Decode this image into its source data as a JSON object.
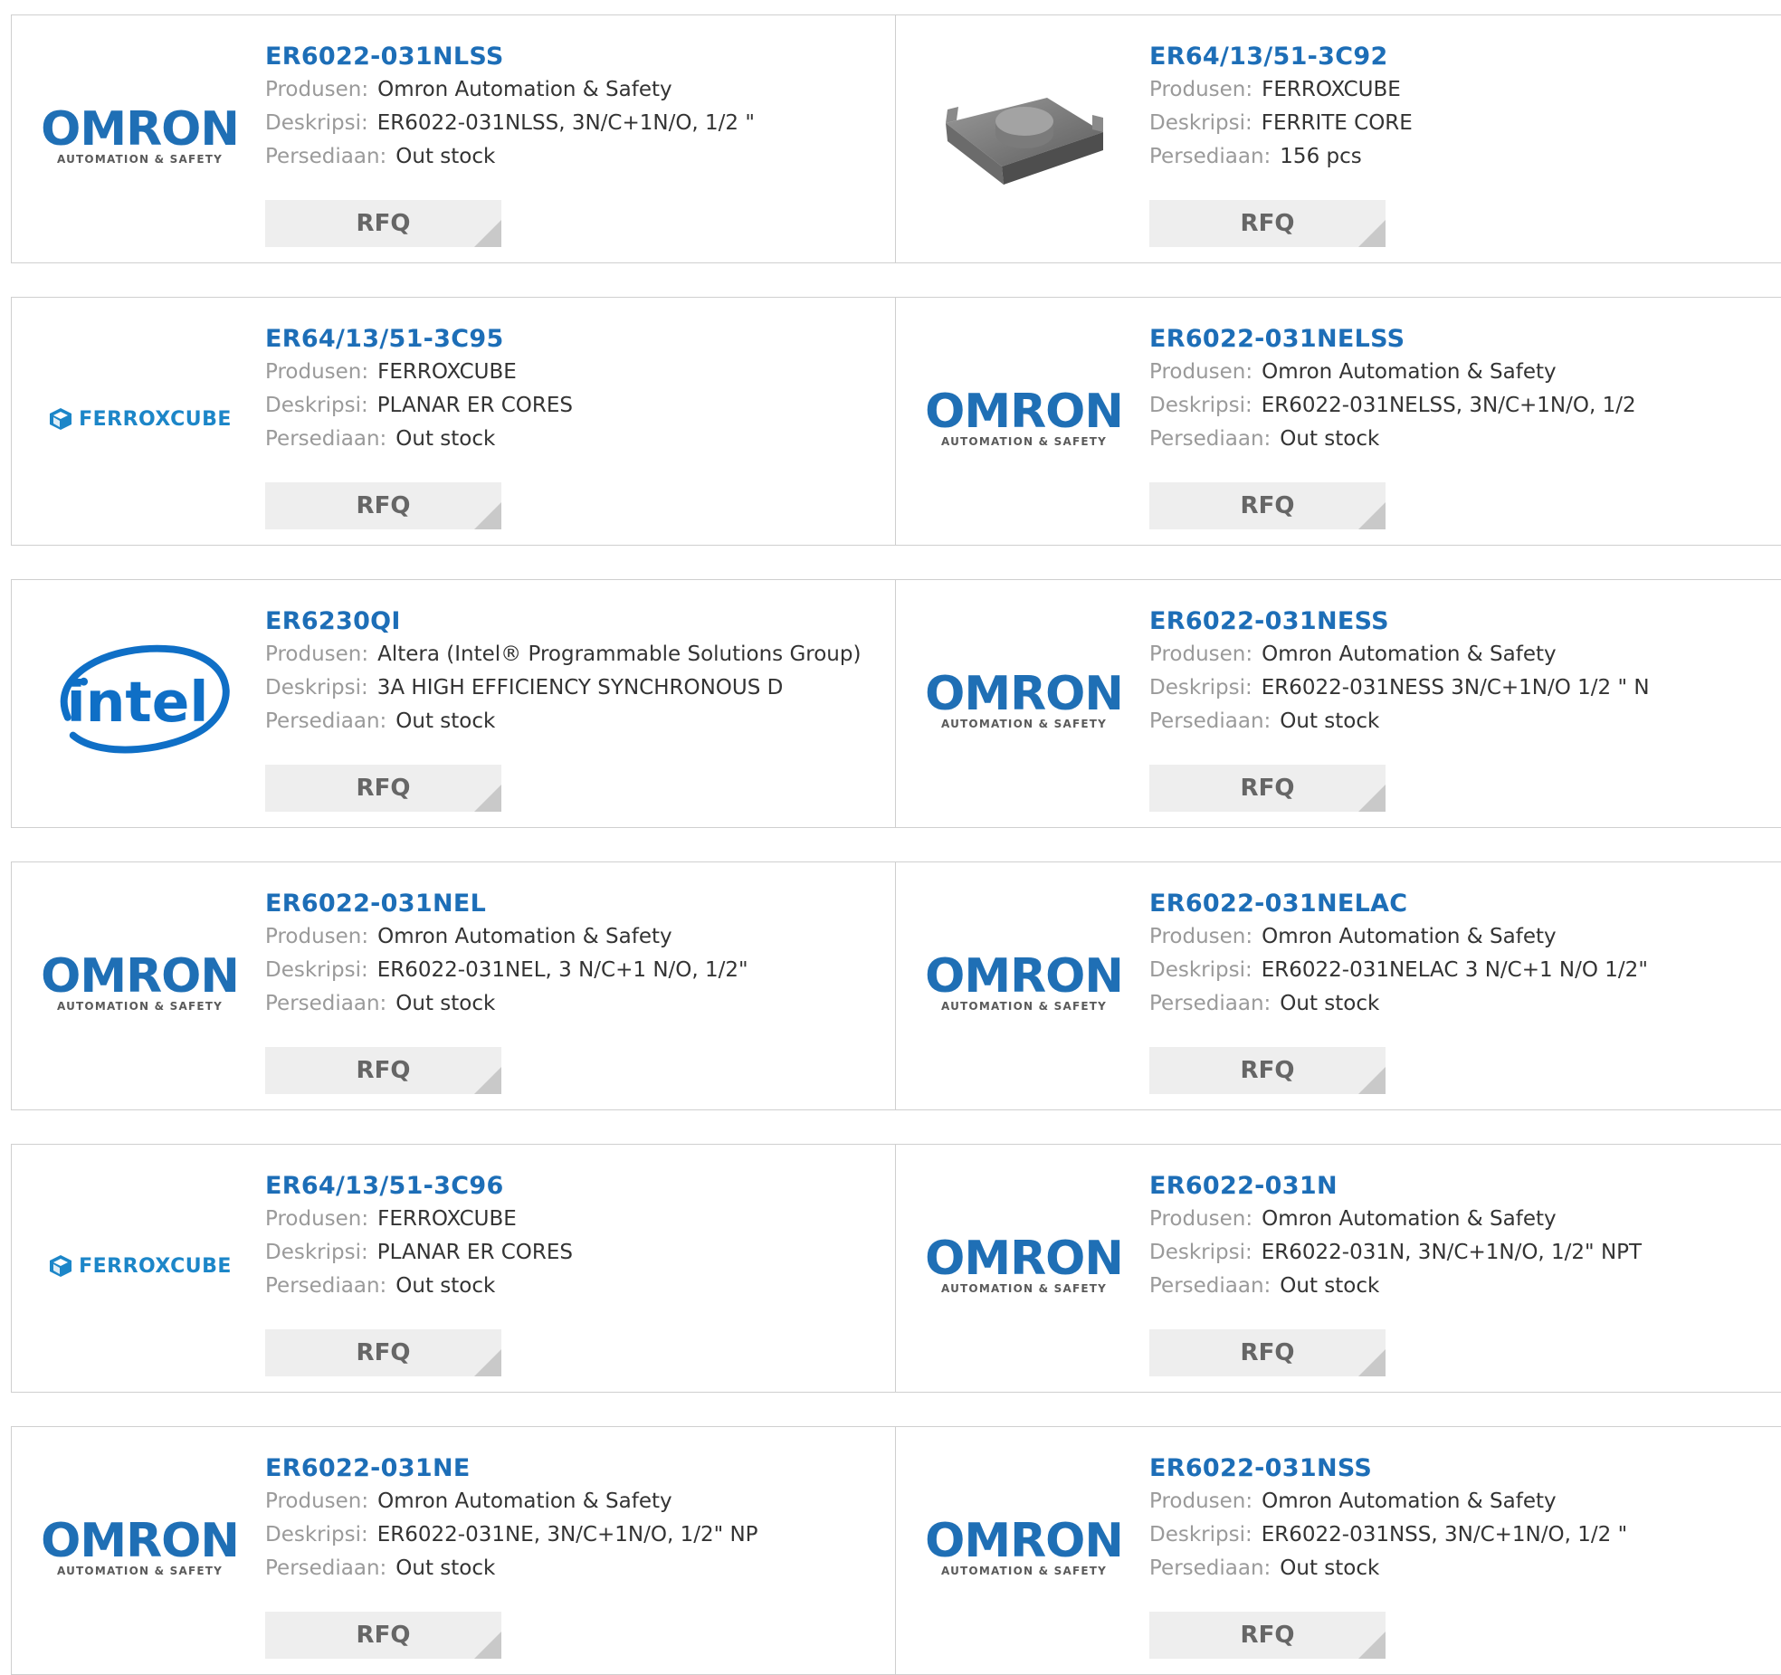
{
  "labels": {
    "manufacturer": "Produsen:",
    "description": "Deskripsi:",
    "stock": "Persediaan:",
    "rfq": "RFQ"
  },
  "brand_logos": {
    "omron": {
      "word": "OMRON",
      "sub": "AUTOMATION & SAFETY",
      "color": "#1f6fb5"
    },
    "ferroxcube": {
      "word": "FERROXCUBE",
      "color": "#1c86c8"
    },
    "intel": {
      "word": "intel",
      "color": "#0f6fc6"
    }
  },
  "colors": {
    "link": "#1d6eb7",
    "label": "#9a9a9a",
    "value": "#333333",
    "button_bg": "#eeeeee"
  },
  "products": [
    {
      "part": "ER6022-031NLSS",
      "manufacturer": "Omron Automation & Safety",
      "description": "ER6022-031NLSS, 3N/C+1N/O, 1/2 \"",
      "stock": "Out stock",
      "logo": "omron"
    },
    {
      "part": "ER64/13/51-3C92",
      "manufacturer": "FERROXCUBE",
      "description": "FERRITE CORE",
      "stock": "156 pcs",
      "logo": "ferrite-core-photo"
    },
    {
      "part": "ER64/13/51-3C95",
      "manufacturer": "FERROXCUBE",
      "description": "PLANAR ER CORES",
      "stock": "Out stock",
      "logo": "ferroxcube"
    },
    {
      "part": "ER6022-031NELSS",
      "manufacturer": "Omron Automation & Safety",
      "description": "ER6022-031NELSS, 3N/C+1N/O, 1/2",
      "stock": "Out stock",
      "logo": "omron"
    },
    {
      "part": "ER6230QI",
      "manufacturer": "Altera (Intel® Programmable Solutions Group)",
      "description": "3A HIGH EFFICIENCY SYNCHRONOUS D",
      "stock": "Out stock",
      "logo": "intel"
    },
    {
      "part": "ER6022-031NESS",
      "manufacturer": "Omron Automation & Safety",
      "description": "ER6022-031NESS 3N/C+1N/O 1/2 \" N",
      "stock": "Out stock",
      "logo": "omron"
    },
    {
      "part": "ER6022-031NEL",
      "manufacturer": "Omron Automation & Safety",
      "description": "ER6022-031NEL, 3 N/C+1 N/O, 1/2\"",
      "stock": "Out stock",
      "logo": "omron"
    },
    {
      "part": "ER6022-031NELAC",
      "manufacturer": "Omron Automation & Safety",
      "description": "ER6022-031NELAC 3 N/C+1 N/O 1/2\"",
      "stock": "Out stock",
      "logo": "omron"
    },
    {
      "part": "ER64/13/51-3C96",
      "manufacturer": "FERROXCUBE",
      "description": "PLANAR ER CORES",
      "stock": "Out stock",
      "logo": "ferroxcube"
    },
    {
      "part": "ER6022-031N",
      "manufacturer": "Omron Automation & Safety",
      "description": "ER6022-031N, 3N/C+1N/O, 1/2\" NPT",
      "stock": "Out stock",
      "logo": "omron"
    },
    {
      "part": "ER6022-031NE",
      "manufacturer": "Omron Automation & Safety",
      "description": "ER6022-031NE, 3N/C+1N/O, 1/2\" NP",
      "stock": "Out stock",
      "logo": "omron"
    },
    {
      "part": "ER6022-031NSS",
      "manufacturer": "Omron Automation & Safety",
      "description": "ER6022-031NSS, 3N/C+1N/O, 1/2 \"",
      "stock": "Out stock",
      "logo": "omron"
    }
  ]
}
